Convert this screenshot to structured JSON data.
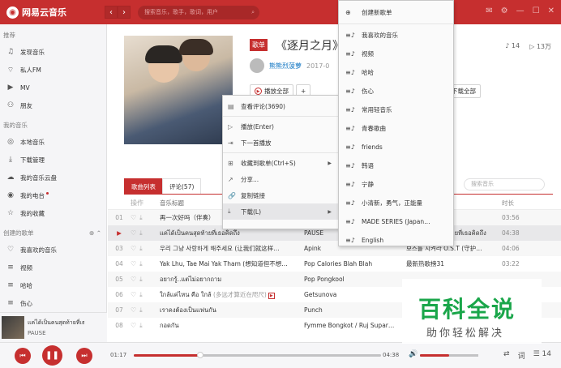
{
  "app": {
    "logo_glyph": "◉",
    "name": "网易云音乐"
  },
  "nav": {
    "back": "‹",
    "forward": "›"
  },
  "search": {
    "placeholder": "搜索音乐，歌手，歌词，用户"
  },
  "topbar": {
    "icons": [
      "mail-icon",
      "gear-icon",
      "minimize-icon",
      "maximize-icon",
      "close-icon"
    ],
    "mail_badge": "1"
  },
  "sidebar": {
    "section_recommend": "推荐",
    "recommend_items": [
      {
        "label": "发现音乐",
        "icon": "♫"
      },
      {
        "label": "私人FM",
        "icon": "📻"
      },
      {
        "label": "MV",
        "icon": "▶"
      },
      {
        "label": "朋友",
        "icon": "👥"
      }
    ],
    "section_mine": "我的音乐",
    "mine_items": [
      {
        "label": "本地音乐",
        "icon": "◎"
      },
      {
        "label": "下载管理",
        "icon": "⤓"
      },
      {
        "label": "我的音乐云盘",
        "icon": "☁"
      },
      {
        "label": "我的电台",
        "icon": "◉"
      },
      {
        "label": "我的收藏",
        "icon": "☆"
      }
    ],
    "section_created": "创建的歌单",
    "created_items": [
      {
        "label": "我喜欢的音乐",
        "icon": "♡"
      },
      {
        "label": "视频",
        "icon": "≡"
      },
      {
        "label": "哈哈",
        "icon": "≡"
      },
      {
        "label": "伤心",
        "icon": "≡"
      }
    ]
  },
  "now_playing": {
    "title": "แค่ได้เป็นคนสุดท้ายที่เธอ",
    "artist": "PAUSE"
  },
  "playlist": {
    "tag": "歌单",
    "title": "《逐月之月》",
    "creator": "熊熊烈菠萝",
    "date": "2017-0",
    "track_count": "14",
    "play_count": "13万",
    "play_all": "播放全部",
    "add": "+",
    "download_all": "下载全部"
  },
  "tabs": {
    "songs": "歌曲列表",
    "comments": "评论(57)",
    "search_placeholder": "搜索音乐"
  },
  "columns": {
    "ops": "操作",
    "title": "音乐标题",
    "duration": "时长"
  },
  "songs": [
    {
      "num": "01",
      "title": "再一次好吗（伴奏）",
      "artist": "",
      "album": "",
      "duration": "03:56",
      "playing": false
    },
    {
      "num": "▶",
      "title": "แค่ได้เป็นคนสุดท้ายที่เธอคิดถึง",
      "artist": "PAUSE",
      "album": "แค่ได้เป็นคนสุดท้ายที่เธอคิดถึง",
      "duration": "04:38",
      "playing": true
    },
    {
      "num": "03",
      "title": "우리 그냥 사랑하게 해주세요 (让我们就这样…",
      "artist": "Apink",
      "album": "보스를 지켜라 O.S.T (守护…",
      "duration": "04:06",
      "playing": false
    },
    {
      "num": "04",
      "title": "Yak Lhu, Tae Mai Yak Tham (想知道但不想…",
      "artist": "Pop Calories Blah Blah",
      "album": "最新热歌榜31",
      "duration": "03:22",
      "playing": false
    },
    {
      "num": "05",
      "title": "อยากรู้..แต่ไม่อยากถาม",
      "artist": "Pop Pongkool",
      "album": "",
      "duration": "",
      "playing": false
    },
    {
      "num": "06",
      "title": "ใกล้แค่ไหน คือ ใกล้",
      "subtitle": "(多远才算近在咫尺)",
      "mv": "▶",
      "artist": "Getsunova",
      "album": "",
      "duration": "",
      "playing": false
    },
    {
      "num": "07",
      "title": "เราคงต้องเป็นแฟนกัน",
      "artist": "Punch",
      "album": "",
      "duration": "",
      "playing": false
    },
    {
      "num": "08",
      "title": "กอดกัน",
      "artist": "Fymme Bongkot / Ruj Supar…",
      "album": "",
      "duration": "",
      "playing": false
    }
  ],
  "context_menu": [
    {
      "label": "查看评论(3690)",
      "icon": "▤"
    },
    {
      "label": "播放(Enter)",
      "icon": "▷"
    },
    {
      "label": "下一首播放",
      "icon": "⇥"
    },
    {
      "label": "收藏到歌单(Ctrl+S)",
      "icon": "⊞",
      "submenu": true
    },
    {
      "label": "分享...",
      "icon": "↗"
    },
    {
      "label": "复制链接",
      "icon": "⛓"
    },
    {
      "label": "下载(L)",
      "icon": "⤓",
      "submenu": true
    }
  ],
  "submenu": [
    {
      "label": "创建新歌单",
      "icon": "⊕"
    },
    {
      "label": "我喜欢的音乐",
      "icon": "≡♪"
    },
    {
      "label": "视频",
      "icon": "≡♪"
    },
    {
      "label": "哈哈",
      "icon": "≡♪"
    },
    {
      "label": "伤心",
      "icon": "≡♪"
    },
    {
      "label": "常用轻音乐",
      "icon": "≡♪"
    },
    {
      "label": "青春歌曲",
      "icon": "≡♪"
    },
    {
      "label": "friends",
      "icon": "≡♪"
    },
    {
      "label": "韩语",
      "icon": "≡♪"
    },
    {
      "label": "宁静",
      "icon": "≡♪"
    },
    {
      "label": "小清新，勇气，正能量",
      "icon": "≡♪"
    },
    {
      "label": "MADE SERIES (Japan…",
      "icon": "≡♪"
    },
    {
      "label": "English",
      "icon": "≡♪"
    }
  ],
  "player": {
    "elapsed": "01:17",
    "total": "04:38",
    "progress_fraction": 0.27,
    "volume_fraction": 0.5,
    "queue_count": "14",
    "accent": "#c62f2f"
  },
  "watermark": {
    "main": "百科全说",
    "sub": "助你轻松解决"
  }
}
